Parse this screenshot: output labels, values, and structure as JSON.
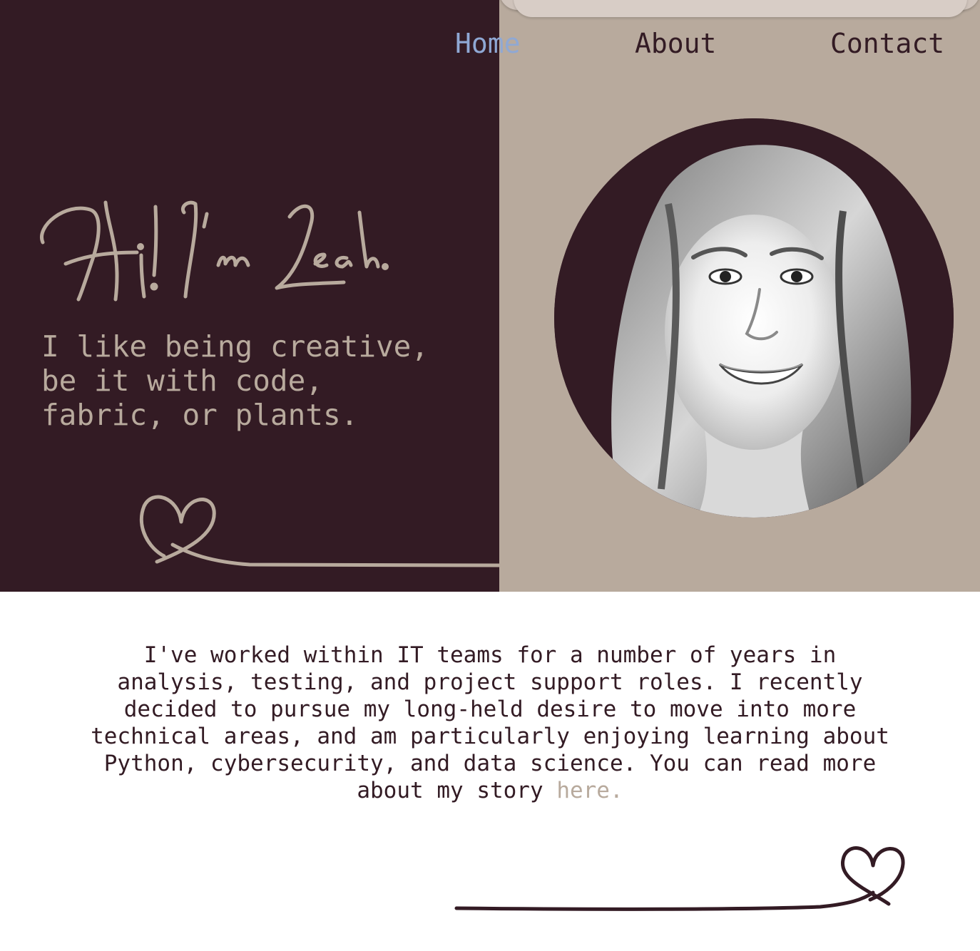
{
  "nav": {
    "home": "Home",
    "about": "About",
    "contact": "Contact"
  },
  "hero": {
    "greeting": "Hi! I'm Leah.",
    "tagline": "I like being creative,\nbe it with code,\nfabric, or plants."
  },
  "bio": {
    "text": "I've worked within IT teams for a number of years in analysis, testing, and project support roles. I recently decided to pursue my long-held desire to move into more technical areas, and am particularly enjoying learning about Python, cybersecurity, and data science. You can read more about my story ",
    "link_text": "here."
  },
  "colors": {
    "dark_plum": "#331b24",
    "taupe": "#b8aa9d",
    "nav_active": "#8fa8d4",
    "white": "#ffffff"
  },
  "icons": {
    "heart_top": "heart-line-icon",
    "heart_bottom": "heart-line-icon"
  }
}
